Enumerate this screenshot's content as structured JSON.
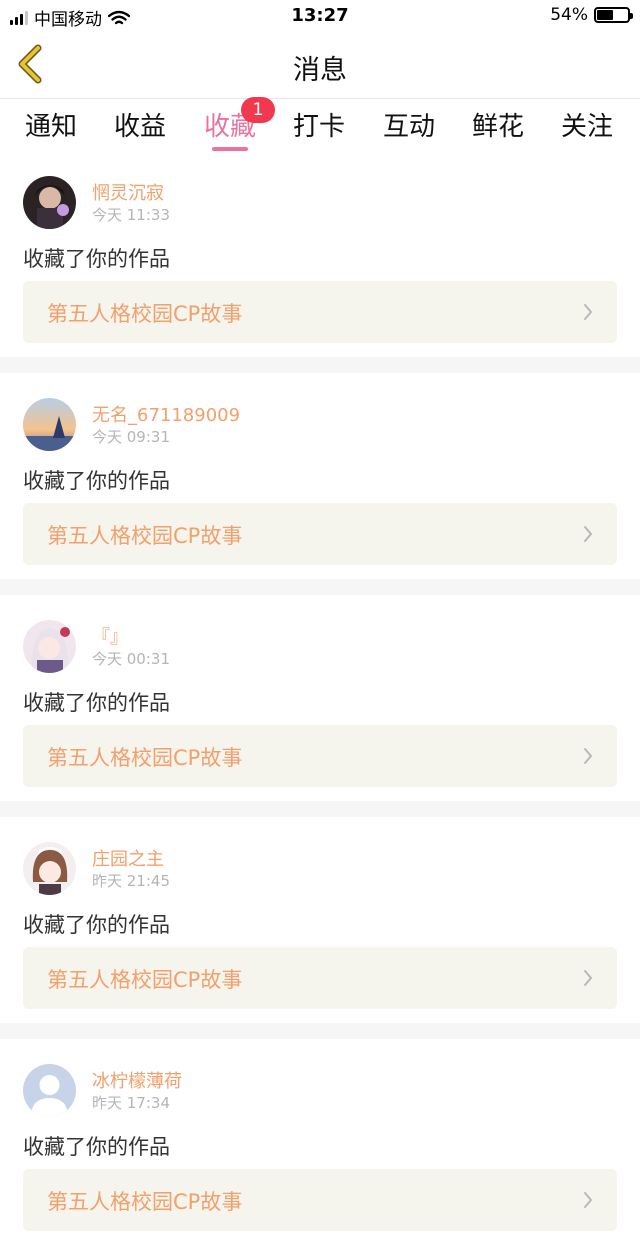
{
  "status_bar": {
    "carrier": "中国移动",
    "time": "13:27",
    "battery": "54%",
    "battery_level": 0.54
  },
  "nav": {
    "title": "消息",
    "back_icon": "back-chevron-icon"
  },
  "tabs": [
    {
      "label": "通知"
    },
    {
      "label": "收益"
    },
    {
      "label": "收藏",
      "active": true,
      "badge": "1"
    },
    {
      "label": "打卡"
    },
    {
      "label": "互动"
    },
    {
      "label": "鲜花"
    },
    {
      "label": "关注"
    }
  ],
  "notifications": [
    {
      "username": "惘灵沉寂",
      "time": "今天 11:33",
      "action": "收藏了你的作品",
      "work_title": "第五人格校园CP故事"
    },
    {
      "username": "无名_671189009",
      "time": "今天 09:31",
      "action": "收藏了你的作品",
      "work_title": "第五人格校园CP故事"
    },
    {
      "username": "『』",
      "time": "今天 00:31",
      "action": "收藏了你的作品",
      "work_title": "第五人格校园CP故事"
    },
    {
      "username": "庄园之主",
      "time": "昨天 21:45",
      "action": "收藏了你的作品",
      "work_title": "第五人格校园CP故事"
    },
    {
      "username": "冰柠檬薄荷",
      "time": "昨天 17:34",
      "action": "收藏了你的作品",
      "work_title": "第五人格校园CP故事"
    }
  ],
  "colors": {
    "accent": "#e8739f",
    "username": "#f2a06c",
    "badge": "#f2384f",
    "back_icon": "#e9c230"
  }
}
